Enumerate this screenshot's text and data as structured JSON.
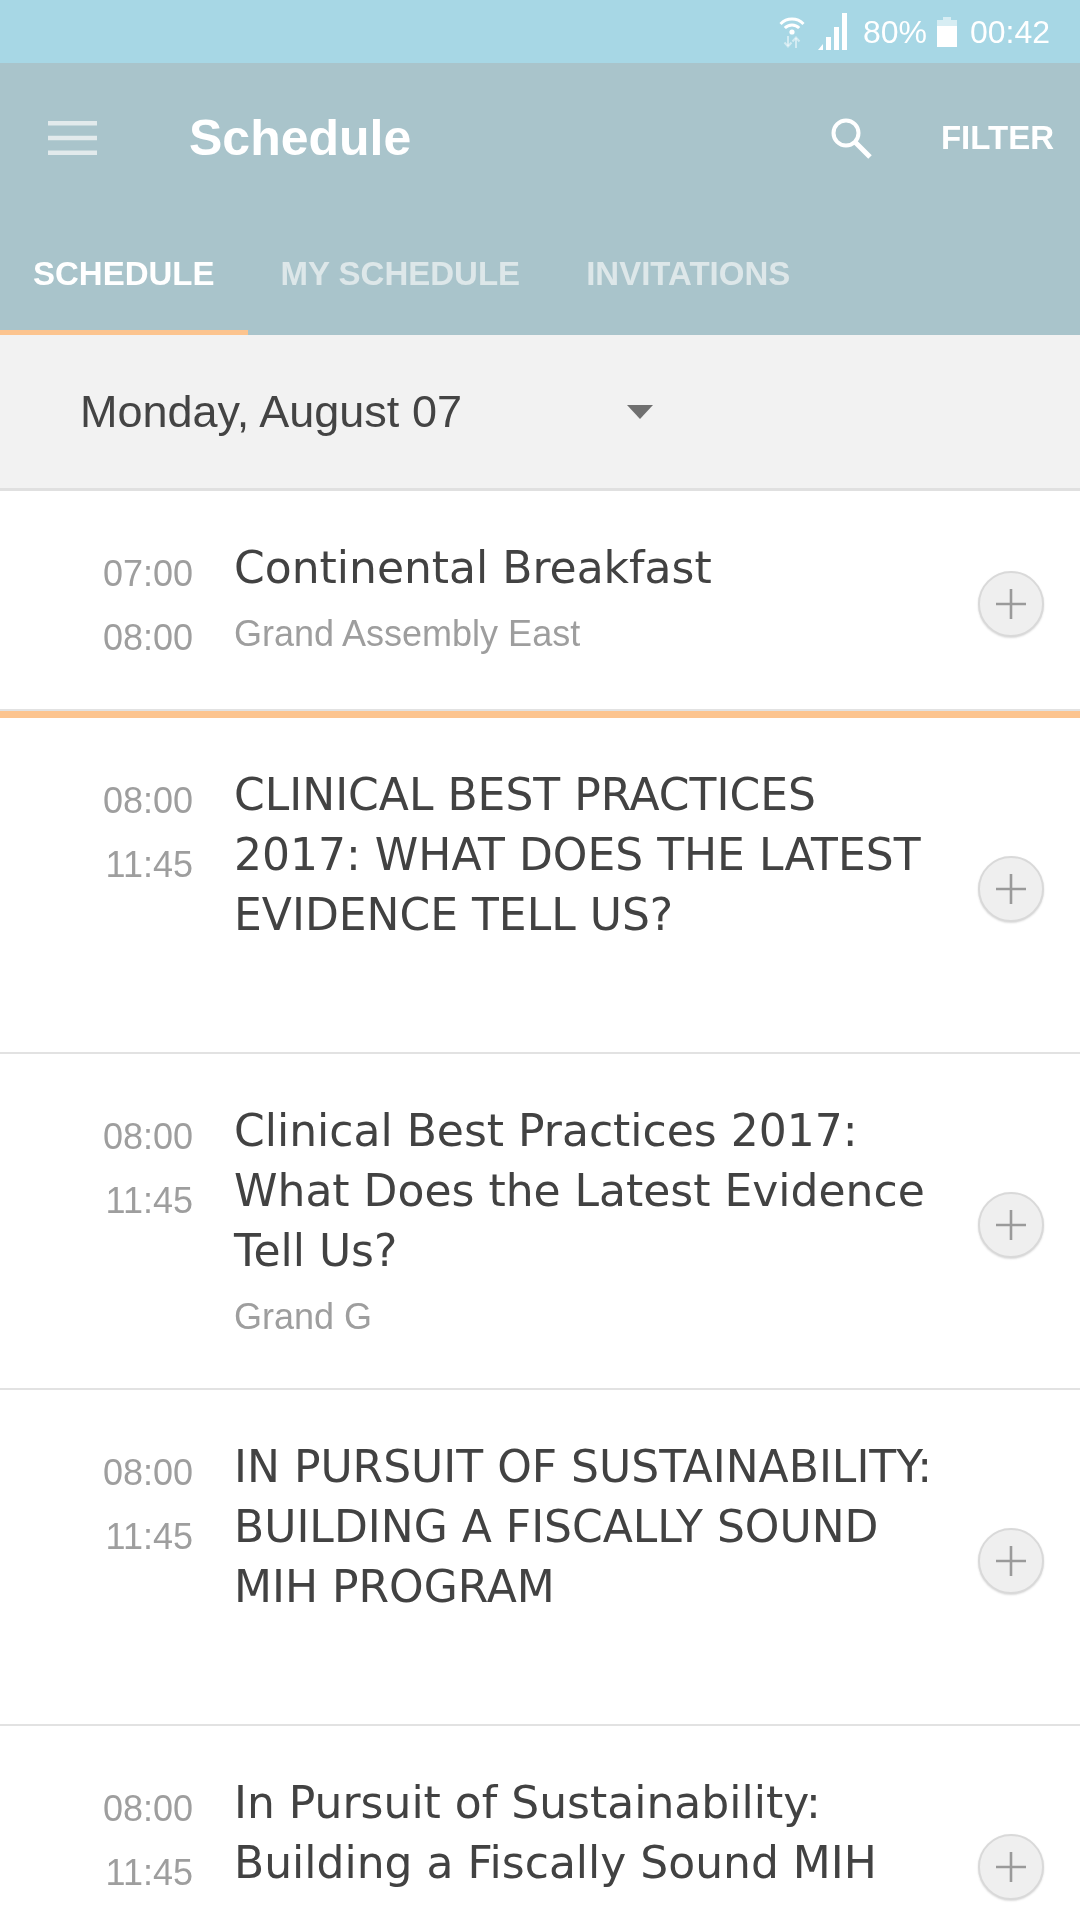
{
  "status_bar": {
    "battery": "80%",
    "time": "00:42"
  },
  "app_bar": {
    "title": "Schedule",
    "action": "FILTER"
  },
  "tabs": [
    {
      "label": "SCHEDULE",
      "selected": true
    },
    {
      "label": "MY SCHEDULE",
      "selected": false
    },
    {
      "label": "INVITATIONS",
      "selected": false
    }
  ],
  "date_selector": {
    "value": "Monday, August 07"
  },
  "sessions": [
    {
      "start": "07:00",
      "end": "08:00",
      "title": "Continental Breakfast",
      "location": "Grand Assembly East",
      "now_marker": true
    },
    {
      "start": "08:00",
      "end": "11:45",
      "title": "CLINICAL BEST PRACTICES 2017: WHAT DOES THE LATEST EVIDENCE TELL US?",
      "now_marker": false
    },
    {
      "start": "08:00",
      "end": "11:45",
      "title": "Clinical Best Practices 2017: What Does the Latest Evidence Tell Us?",
      "location": "Grand G",
      "now_marker": false
    },
    {
      "start": "08:00",
      "end": "11:45",
      "title": "IN PURSUIT OF SUSTAINABILITY: BUILDING A FISCALLY SOUND MIH PROGRAM",
      "now_marker": false
    },
    {
      "start": "08:00",
      "end": "11:45",
      "title": "In Pursuit of Sustainability: Building a Fiscally Sound MIH",
      "now_marker": false
    }
  ]
}
